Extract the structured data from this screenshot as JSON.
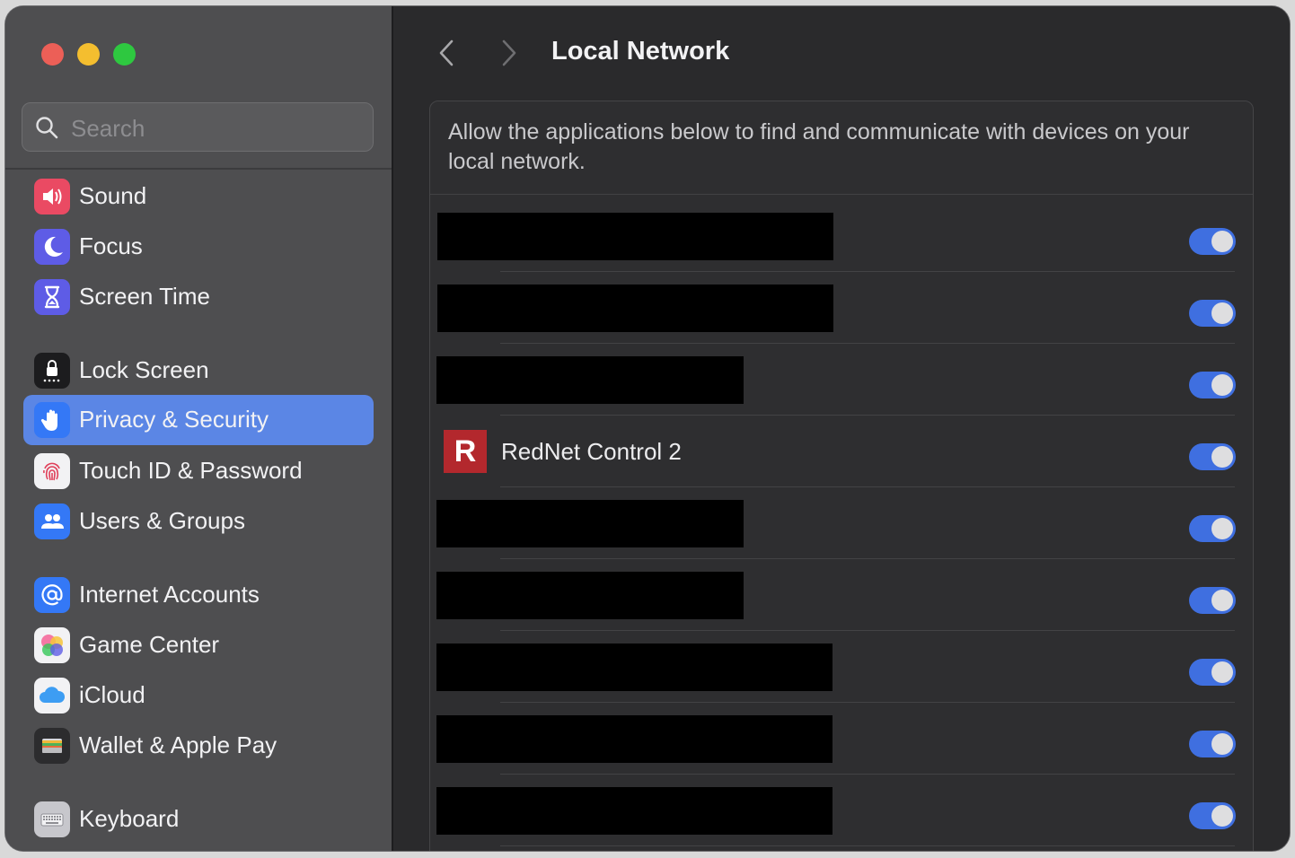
{
  "sidebar": {
    "search_placeholder": "Search",
    "items": [
      {
        "label": "Sound",
        "icon": "speaker-icon",
        "color": "#ea4a63"
      },
      {
        "label": "Focus",
        "icon": "moon-icon",
        "color": "#5e5ce6"
      },
      {
        "label": "Screen Time",
        "icon": "hourglass-icon",
        "color": "#5e5ce6"
      },
      {
        "label": "Lock Screen",
        "icon": "lock-icon",
        "color": "#1c1c1e"
      },
      {
        "label": "Privacy & Security",
        "icon": "hand-icon",
        "color": "#3478f6",
        "selected": true
      },
      {
        "label": "Touch ID & Password",
        "icon": "fingerprint-icon",
        "color": "#f2f2f4"
      },
      {
        "label": "Users & Groups",
        "icon": "users-icon",
        "color": "#3478f6"
      },
      {
        "label": "Internet Accounts",
        "icon": "at-icon",
        "color": "#3478f6"
      },
      {
        "label": "Game Center",
        "icon": "game-center-icon",
        "color": "#f2f2f4"
      },
      {
        "label": "iCloud",
        "icon": "cloud-icon",
        "color": "#f2f2f4"
      },
      {
        "label": "Wallet & Apple Pay",
        "icon": "wallet-icon",
        "color": "#2c2c2e"
      },
      {
        "label": "Keyboard",
        "icon": "keyboard-icon",
        "color": "#c7c7cc"
      }
    ]
  },
  "header": {
    "title": "Local Network"
  },
  "panel": {
    "description": "Allow the applications below to find and communicate with devices on your local network.",
    "apps": [
      {
        "name": "",
        "redacted": true,
        "enabled": true
      },
      {
        "name": "",
        "redacted": true,
        "enabled": true
      },
      {
        "name": "",
        "redacted": true,
        "enabled": true
      },
      {
        "name": "RedNet Control 2",
        "redacted": false,
        "enabled": true,
        "icon_letter": "R",
        "icon_color": "#b3282d"
      },
      {
        "name": "",
        "redacted": true,
        "enabled": true
      },
      {
        "name": "",
        "redacted": true,
        "enabled": true
      },
      {
        "name": "",
        "redacted": true,
        "enabled": true
      },
      {
        "name": "",
        "redacted": true,
        "enabled": true
      },
      {
        "name": "",
        "redacted": true,
        "enabled": true
      }
    ]
  },
  "colors": {
    "accent": "#5b86e5",
    "toggle_on": "#3f6fe0"
  }
}
